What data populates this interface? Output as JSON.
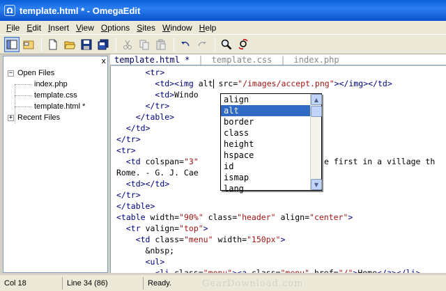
{
  "window": {
    "title": "template.html * - OmegaEdit",
    "app_icon_glyph": "Ω"
  },
  "menu": [
    {
      "label": "File",
      "accel": "F",
      "rest": "ile"
    },
    {
      "label": "Edit",
      "accel": "E",
      "rest": "dit"
    },
    {
      "label": "Insert",
      "accel": "I",
      "rest": "nsert"
    },
    {
      "label": "View",
      "accel": "V",
      "rest": "iew"
    },
    {
      "label": "Options",
      "accel": "O",
      "rest": "ptions"
    },
    {
      "label": "Sites",
      "accel": "S",
      "rest": "ites"
    },
    {
      "label": "Window",
      "accel": "W",
      "rest": "indow"
    },
    {
      "label": "Help",
      "accel": "H",
      "rest": "elp"
    }
  ],
  "toolbar": {
    "icons": [
      "panel-toggle-icon",
      "folder-panel-icon",
      "new-file-icon",
      "open-file-icon",
      "save-icon",
      "save-all-icon",
      "cut-icon",
      "copy-icon",
      "paste-icon",
      "undo-icon",
      "redo-icon",
      "find-icon",
      "replace-icon"
    ]
  },
  "sidebar": {
    "close_glyph": "x",
    "open_files_label": "Open Files",
    "open_files_expander": "−",
    "files": [
      "index.php",
      "template.css",
      "template.html *"
    ],
    "recent_files_label": "Recent Files",
    "recent_files_expander": "+"
  },
  "tabs": {
    "items": [
      "template.html *",
      "template.css",
      "index.php"
    ],
    "separator": "|"
  },
  "editor": {
    "lines": [
      "      <tr>",
      "        <td><img alt",
      "        <td>Windo",
      "      </tr>",
      "    </table>",
      "  </td>",
      "</tr>",
      "<tr>",
      "  <td colspan=\"3\"",
      "Rome. - G. J. Cae",
      "  <td></td>",
      "</tr>",
      "</table>",
      "<table width=\"90%\" class=\"header\" align=\"center\">",
      "  <tr valign=\"top\">",
      "    <td class=\"menu\" width=\"150px\">",
      "      &nbsp;",
      "      <ul>",
      "        <li class=\"menu\"><a class=\"menu\" href=\"/\">Home</a></li>"
    ],
    "line1_suffix": " src=\"/images/accept.png\"></img></td>",
    "line8_suffix": "e first in a village th",
    "line2_suffix": ""
  },
  "autocomplete": {
    "items": [
      "align",
      "alt",
      "border",
      "class",
      "height",
      "hspace",
      "id",
      "ismap",
      "lang"
    ],
    "selected_index": 1
  },
  "status": {
    "col": "Col 18",
    "line": "Line 34 (86)",
    "state": "Ready."
  },
  "watermark": "GearDownload.com"
}
